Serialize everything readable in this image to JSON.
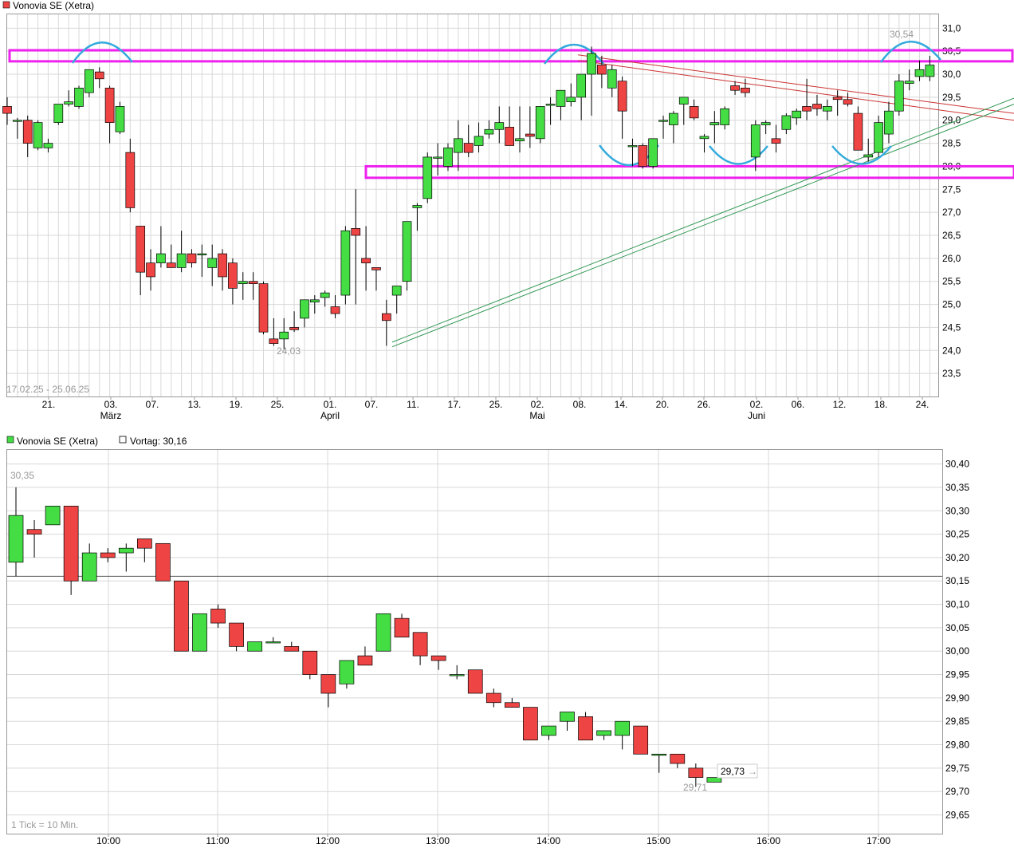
{
  "colors": {
    "up": "#44dd44",
    "down": "#ee4444",
    "wick": "#000000",
    "grid": "#d8d8d8",
    "magenta": "#ee22ee",
    "cyan": "#33aadd",
    "redline": "#cc3333",
    "greenline": "#339955"
  },
  "top": {
    "legend": "Vonovia SE (Xetra)",
    "date_range": "17.02.25 - 25.06.25",
    "min_label": "24,03",
    "max_label": "30,54"
  },
  "bottom": {
    "legend": "Vonovia SE (Xetra)",
    "prev_label": "Vortag: 30,16",
    "tick_note": "1 Tick = 10 Min.",
    "high_label": "30,35",
    "low_label": "29,71",
    "last_label": "29,73"
  },
  "chart_data": [
    {
      "type": "candlestick",
      "title": "Vonovia SE (Xetra)",
      "ylim": [
        23,
        31.3
      ],
      "y_ticks": [
        "23,5",
        "24,0",
        "24,5",
        "25,0",
        "25,5",
        "26,0",
        "26,5",
        "27,0",
        "27,5",
        "28,0",
        "28,5",
        "29,0",
        "29,5",
        "30,0",
        "30,5",
        "31,0"
      ],
      "x_ticks": [
        "21.",
        "03.",
        "07.",
        "13.",
        "19.",
        "25.",
        "01.",
        "07.",
        "11.",
        "17.",
        "25.",
        "02.",
        "08.",
        "14.",
        "20.",
        "26.",
        "02.",
        "06.",
        "12.",
        "18.",
        "24."
      ],
      "x_month_labels": [
        "März",
        "April",
        "Mai",
        "Juni"
      ],
      "ohlc": [
        [
          29.3,
          29.5,
          28.9,
          29.15
        ],
        [
          29.0,
          29.05,
          28.6,
          29.0
        ],
        [
          29.0,
          29.1,
          28.2,
          28.5
        ],
        [
          28.4,
          29.0,
          28.35,
          28.95
        ],
        [
          28.4,
          28.6,
          28.3,
          28.5
        ],
        [
          28.95,
          29.35,
          28.9,
          29.35
        ],
        [
          29.35,
          29.65,
          29.3,
          29.4
        ],
        [
          29.3,
          29.75,
          29.25,
          29.7
        ],
        [
          29.6,
          30.05,
          29.5,
          30.1
        ],
        [
          30.05,
          30.15,
          29.7,
          29.9
        ],
        [
          29.7,
          29.75,
          28.5,
          28.95
        ],
        [
          28.75,
          29.4,
          28.7,
          29.3
        ],
        [
          28.3,
          28.6,
          27.0,
          27.1
        ],
        [
          26.7,
          26.7,
          25.2,
          25.7
        ],
        [
          25.9,
          26.2,
          25.3,
          25.6
        ],
        [
          25.9,
          26.7,
          25.8,
          26.1
        ],
        [
          25.9,
          26.3,
          25.8,
          25.8
        ],
        [
          25.8,
          26.6,
          25.7,
          26.1
        ],
        [
          26.1,
          26.2,
          25.8,
          25.9
        ],
        [
          26.1,
          26.3,
          25.6,
          26.1
        ],
        [
          25.8,
          26.3,
          25.4,
          26.0
        ],
        [
          26.1,
          26.2,
          25.3,
          25.6
        ],
        [
          25.9,
          26.0,
          25.0,
          25.35
        ],
        [
          25.45,
          25.7,
          25.1,
          25.5
        ],
        [
          25.5,
          25.7,
          25.1,
          25.45
        ],
        [
          25.45,
          25.5,
          24.35,
          24.4
        ],
        [
          24.25,
          24.7,
          24.1,
          24.15
        ],
        [
          24.25,
          24.7,
          24.03,
          24.4
        ],
        [
          24.5,
          24.85,
          24.4,
          24.45
        ],
        [
          24.7,
          25.1,
          24.5,
          25.1
        ],
        [
          25.05,
          25.2,
          24.8,
          25.1
        ],
        [
          25.15,
          25.3,
          24.95,
          25.25
        ],
        [
          24.95,
          25.2,
          24.7,
          24.8
        ],
        [
          25.2,
          26.7,
          25.0,
          26.6
        ],
        [
          26.65,
          27.5,
          25.0,
          26.5
        ],
        [
          26.0,
          26.7,
          25.3,
          25.9
        ],
        [
          25.8,
          25.8,
          25.3,
          25.75
        ],
        [
          24.8,
          25.1,
          24.1,
          24.65
        ],
        [
          25.2,
          25.4,
          24.8,
          25.4
        ],
        [
          25.5,
          26.6,
          25.3,
          26.8
        ],
        [
          27.1,
          27.2,
          26.6,
          27.15
        ],
        [
          27.3,
          28.3,
          27.2,
          28.2
        ],
        [
          28.2,
          28.5,
          27.8,
          28.2
        ],
        [
          28.0,
          28.5,
          27.9,
          28.4
        ],
        [
          28.3,
          29.0,
          27.9,
          28.6
        ],
        [
          28.5,
          28.9,
          28.2,
          28.3
        ],
        [
          28.45,
          28.95,
          28.3,
          28.65
        ],
        [
          28.7,
          29.0,
          28.6,
          28.8
        ],
        [
          28.8,
          29.3,
          28.5,
          28.95
        ],
        [
          28.85,
          29.3,
          28.5,
          28.45
        ],
        [
          28.55,
          29.3,
          28.3,
          28.6
        ],
        [
          28.7,
          29.3,
          28.4,
          28.65
        ],
        [
          28.6,
          29.3,
          28.5,
          29.3
        ],
        [
          29.35,
          29.5,
          28.9,
          29.35
        ],
        [
          29.3,
          29.6,
          29.0,
          29.65
        ],
        [
          29.4,
          29.8,
          29.3,
          29.5
        ],
        [
          29.5,
          29.8,
          29.0,
          30.0
        ],
        [
          30.0,
          30.6,
          29.1,
          30.45
        ],
        [
          30.2,
          30.4,
          29.7,
          30.0
        ],
        [
          29.7,
          30.2,
          29.5,
          30.1
        ],
        [
          29.85,
          29.95,
          28.6,
          29.2
        ],
        [
          28.45,
          28.6,
          28.0,
          28.45
        ],
        [
          28.45,
          28.5,
          27.95,
          28.0
        ],
        [
          28.0,
          28.55,
          27.95,
          28.6
        ],
        [
          29.0,
          29.1,
          28.6,
          29.0
        ],
        [
          28.9,
          29.2,
          28.5,
          29.15
        ],
        [
          29.35,
          29.5,
          28.9,
          29.5
        ],
        [
          29.3,
          29.45,
          29.0,
          29.05
        ],
        [
          28.6,
          28.7,
          28.3,
          28.65
        ],
        [
          28.9,
          29.2,
          28.5,
          28.95
        ],
        [
          28.9,
          29.3,
          28.8,
          29.25
        ],
        [
          29.75,
          29.85,
          29.55,
          29.65
        ],
        [
          29.7,
          29.9,
          29.5,
          29.6
        ],
        [
          28.2,
          29.0,
          27.9,
          28.9
        ],
        [
          28.9,
          29.0,
          28.7,
          28.95
        ],
        [
          28.6,
          28.9,
          28.3,
          28.5
        ],
        [
          28.8,
          29.15,
          28.7,
          29.1
        ],
        [
          29.05,
          29.25,
          28.9,
          29.2
        ],
        [
          29.3,
          29.9,
          29.0,
          29.2
        ],
        [
          29.35,
          29.55,
          29.1,
          29.25
        ],
        [
          29.2,
          29.45,
          29.0,
          29.3
        ],
        [
          29.5,
          29.65,
          29.1,
          29.45
        ],
        [
          29.45,
          29.6,
          29.3,
          29.35
        ],
        [
          29.15,
          29.3,
          28.4,
          28.35
        ],
        [
          28.2,
          28.6,
          28.1,
          28.25
        ],
        [
          28.3,
          29.1,
          28.2,
          28.95
        ],
        [
          28.7,
          29.4,
          28.5,
          29.2
        ],
        [
          29.2,
          30.0,
          29.1,
          29.85
        ],
        [
          29.8,
          30.1,
          29.65,
          29.85
        ],
        [
          29.95,
          30.3,
          29.85,
          30.1
        ],
        [
          29.95,
          30.4,
          29.85,
          30.2
        ],
        [
          30.2,
          30.54,
          30.0,
          30.1
        ],
        [
          30.2,
          30.3,
          29.75,
          29.75
        ]
      ],
      "overlays": {
        "resistance_band": [
          30.28,
          30.52
        ],
        "support_band": [
          27.75,
          28.0
        ],
        "red_channel": [
          [
            30.42,
            29.15
          ],
          [
            30.3,
            29.0
          ]
        ],
        "green_channel": [
          [
            24.18,
            29.48
          ],
          [
            24.08,
            29.35
          ]
        ]
      }
    },
    {
      "type": "candlestick",
      "title": "Vonovia SE (Xetra) intraday",
      "ylim": [
        29.61,
        30.43
      ],
      "y_ticks": [
        "29,65",
        "29,70",
        "29,75",
        "29,80",
        "29,85",
        "29,90",
        "29,95",
        "30,00",
        "30,05",
        "30,10",
        "30,15",
        "30,20",
        "30,25",
        "30,30",
        "30,35",
        "30,40"
      ],
      "x_ticks": [
        "10:00",
        "11:00",
        "12:00",
        "13:00",
        "14:00",
        "15:00",
        "16:00",
        "17:00"
      ],
      "previous_close": 30.16,
      "ohlc": [
        [
          30.19,
          30.35,
          30.16,
          30.29
        ],
        [
          30.26,
          30.28,
          30.2,
          30.25
        ],
        [
          30.27,
          30.31,
          30.27,
          30.31
        ],
        [
          30.31,
          30.31,
          30.12,
          30.15
        ],
        [
          30.15,
          30.23,
          30.15,
          30.21
        ],
        [
          30.21,
          30.22,
          30.19,
          30.2
        ],
        [
          30.21,
          30.23,
          30.17,
          30.22
        ],
        [
          30.24,
          30.24,
          30.19,
          30.22
        ],
        [
          30.23,
          30.23,
          30.15,
          30.15
        ],
        [
          30.15,
          30.15,
          30.0,
          30.0
        ],
        [
          30.0,
          30.08,
          30.0,
          30.08
        ],
        [
          30.09,
          30.1,
          30.05,
          30.06
        ],
        [
          30.06,
          30.06,
          30.0,
          30.01
        ],
        [
          30.0,
          30.02,
          30.0,
          30.02
        ],
        [
          30.02,
          30.03,
          30.02,
          30.02
        ],
        [
          30.01,
          30.02,
          30.0,
          30.0
        ],
        [
          30.0,
          30.0,
          29.94,
          29.95
        ],
        [
          29.95,
          29.95,
          29.88,
          29.91
        ],
        [
          29.93,
          29.98,
          29.92,
          29.98
        ],
        [
          29.99,
          30.01,
          29.97,
          29.97
        ],
        [
          30.0,
          30.08,
          30.0,
          30.08
        ],
        [
          30.07,
          30.08,
          30.03,
          30.03
        ],
        [
          30.04,
          30.04,
          29.97,
          29.99
        ],
        [
          29.99,
          29.99,
          29.96,
          29.98
        ],
        [
          29.95,
          29.97,
          29.94,
          29.95
        ],
        [
          29.96,
          29.96,
          29.91,
          29.91
        ],
        [
          29.91,
          29.92,
          29.88,
          29.89
        ],
        [
          29.89,
          29.9,
          29.88,
          29.88
        ],
        [
          29.88,
          29.88,
          29.81,
          29.81
        ],
        [
          29.82,
          29.84,
          29.81,
          29.84
        ],
        [
          29.85,
          29.87,
          29.83,
          29.87
        ],
        [
          29.86,
          29.87,
          29.81,
          29.81
        ],
        [
          29.82,
          29.83,
          29.81,
          29.83
        ],
        [
          29.82,
          29.85,
          29.79,
          29.85
        ],
        [
          29.84,
          29.84,
          29.78,
          29.78
        ],
        [
          29.78,
          29.78,
          29.74,
          29.78
        ],
        [
          29.78,
          29.78,
          29.75,
          29.76
        ],
        [
          29.75,
          29.76,
          29.71,
          29.73
        ],
        [
          29.72,
          29.73,
          29.72,
          29.73
        ]
      ]
    }
  ]
}
